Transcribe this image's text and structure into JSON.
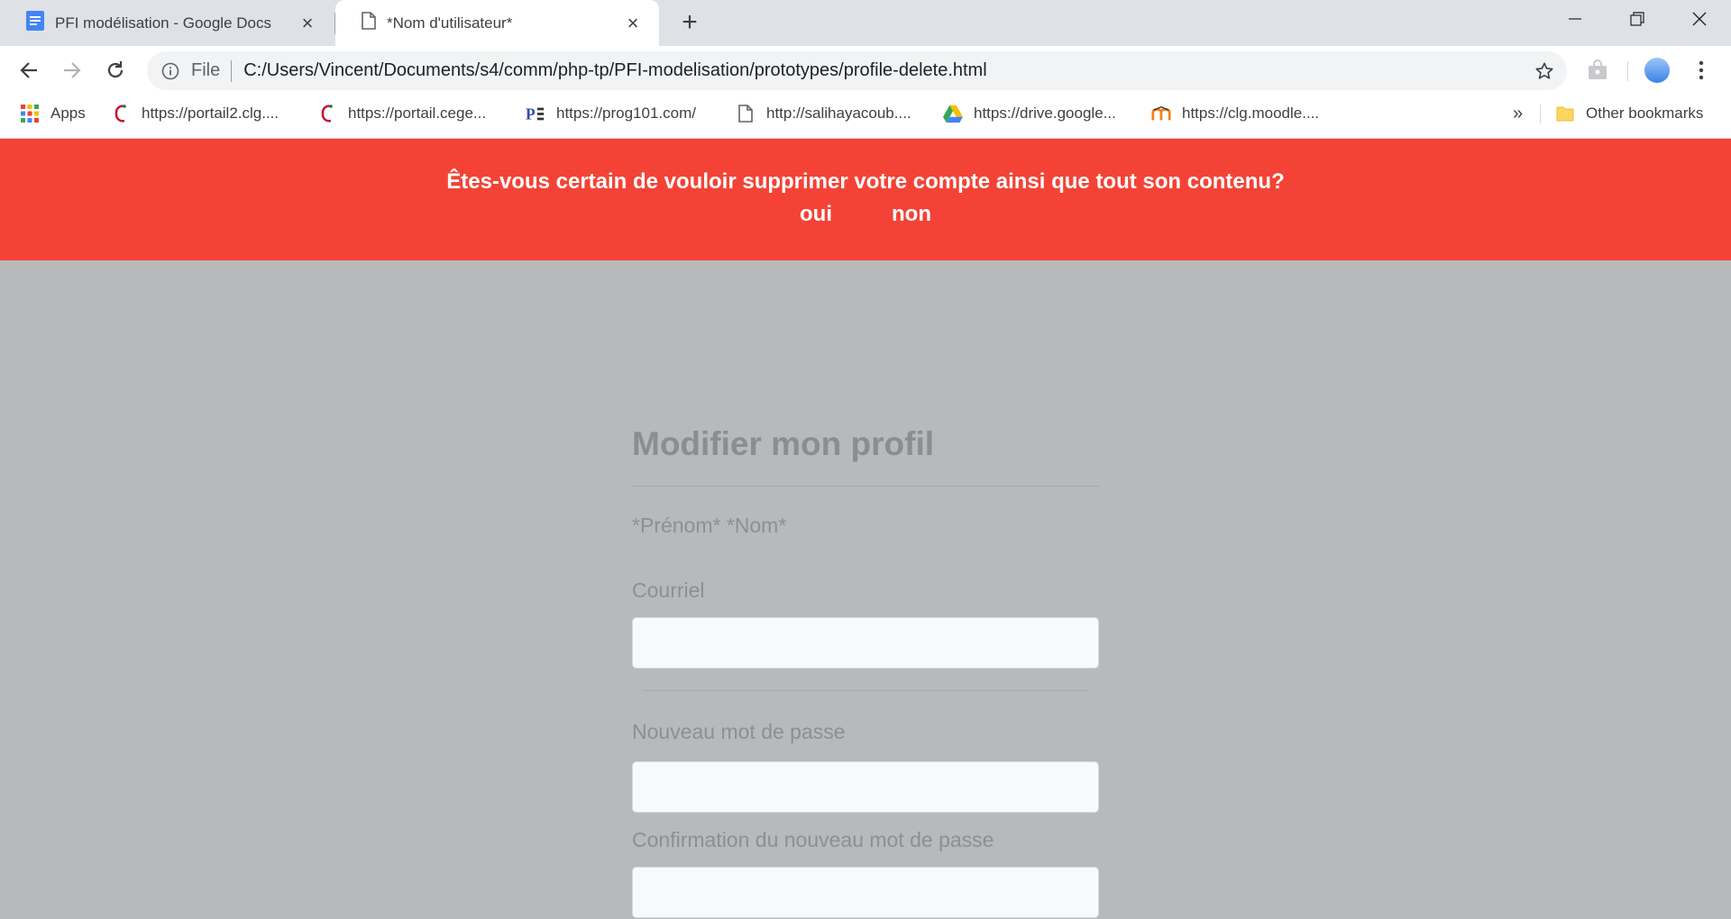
{
  "browser": {
    "tabs": [
      {
        "title": "PFI modélisation - Google Docs",
        "icon": "google-docs-icon"
      },
      {
        "title": "*Nom d'utilisateur*",
        "icon": "page-icon"
      }
    ],
    "address": {
      "scheme_label": "File",
      "url": "C:/Users/Vincent/Documents/s4/comm/php-tp/PFI-modelisation/prototypes/profile-delete.html"
    },
    "bookmarks": [
      {
        "label": "Apps",
        "icon": "apps-grid-icon"
      },
      {
        "label": "https://portail2.clg....",
        "icon": "clg-icon"
      },
      {
        "label": "https://portail.cege...",
        "icon": "cegep-icon"
      },
      {
        "label": "https://prog101.com/",
        "icon": "prog101-icon"
      },
      {
        "label": "http://salihayacoub....",
        "icon": "page-icon"
      },
      {
        "label": "https://drive.google...",
        "icon": "google-drive-icon"
      },
      {
        "label": "https://clg.moodle....",
        "icon": "moodle-icon"
      }
    ],
    "overflow_label": "»",
    "other_bookmarks_label": "Other bookmarks"
  },
  "banner": {
    "message": "Êtes-vous certain de vouloir supprimer votre compte ainsi que tout son contenu?",
    "yes_label": "oui",
    "no_label": "non",
    "color": "#f44336"
  },
  "profile_form": {
    "title": "Modifier mon profil",
    "name_line": "*Prénom* *Nom*",
    "email_label": "Courriel",
    "email_value": "",
    "new_password_label": "Nouveau mot de passe",
    "new_password_value": "",
    "confirm_password_label": "Confirmation du nouveau mot de passe",
    "confirm_password_value": ""
  }
}
